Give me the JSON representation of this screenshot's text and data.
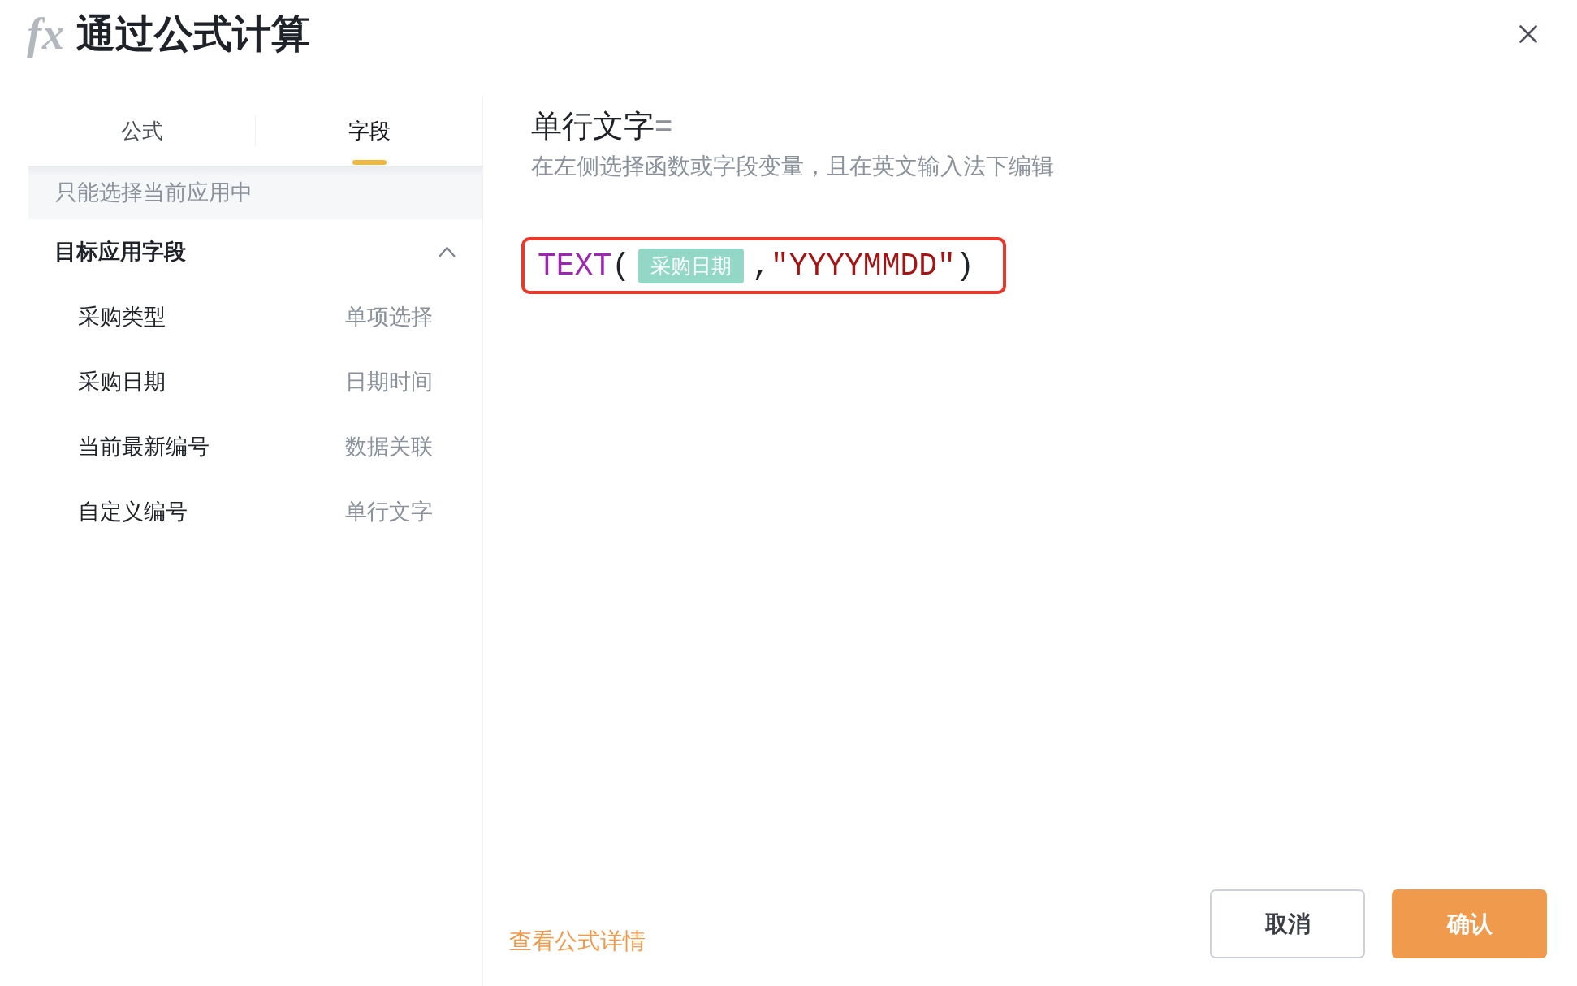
{
  "dialog": {
    "icon_text": "fx",
    "title": "通过公式计算"
  },
  "tabs": [
    {
      "label": "公式",
      "selected": false
    },
    {
      "label": "字段",
      "selected": true
    }
  ],
  "field_panel": {
    "hint": "只能选择当前应用中",
    "groups": [
      {
        "title": "目标应用字段",
        "expanded": true,
        "fields": [
          {
            "name": "采购类型",
            "type": "单项选择"
          },
          {
            "name": "采购日期",
            "type": "日期时间"
          },
          {
            "name": "当前最新编号",
            "type": "数据关联"
          },
          {
            "name": "自定义编号",
            "type": "单行文字"
          }
        ]
      }
    ]
  },
  "editor": {
    "target_field": "单行文字",
    "equals": "=",
    "instruction": "在左侧选择函数或字段变量，且在英文输入法下编辑",
    "highlighted": true,
    "formula": [
      {
        "kind": "function",
        "text": "TEXT"
      },
      {
        "kind": "punctuation",
        "text": "("
      },
      {
        "kind": "field",
        "text": "采购日期"
      },
      {
        "kind": "punctuation",
        "text": ","
      },
      {
        "kind": "string",
        "text": "\"YYYYMMDD\""
      },
      {
        "kind": "punctuation",
        "text": ")"
      }
    ]
  },
  "footer": {
    "link": "查看公式详情",
    "buttons": [
      {
        "label": "取消",
        "kind": "cancel"
      },
      {
        "label": "确认",
        "kind": "confirm"
      }
    ]
  }
}
